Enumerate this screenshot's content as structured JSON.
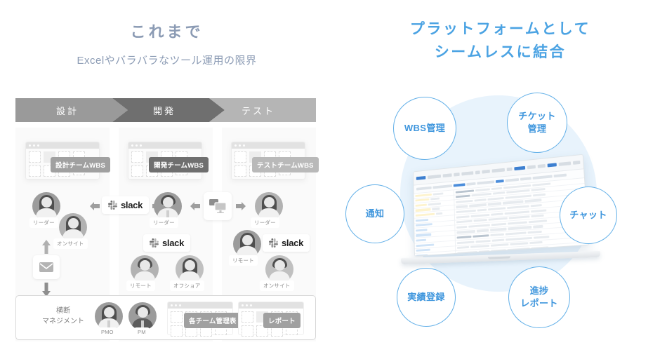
{
  "left": {
    "title": "これまで",
    "subtitle": "Excelやバラバラなツール運用の限界",
    "phases": [
      {
        "label": "設計",
        "color": "#9a9a9a"
      },
      {
        "label": "開発",
        "color": "#6f6f6f"
      },
      {
        "label": "テスト",
        "color": "#b5b5b5"
      }
    ],
    "columns": [
      {
        "wbs_tag": "設計チームWBS",
        "people": [
          {
            "label": "リーダー"
          },
          {
            "label": "オンサイト"
          }
        ],
        "tools": [
          "slack",
          "mail"
        ]
      },
      {
        "wbs_tag": "開発チームWBS",
        "people": [
          {
            "label": "リーダー"
          },
          {
            "label": "リモート"
          },
          {
            "label": "オフショア"
          }
        ],
        "tools": [
          "slack",
          "screen-share"
        ]
      },
      {
        "wbs_tag": "テストチームWBS",
        "people": [
          {
            "label": "リーダー"
          },
          {
            "label": "リモート"
          },
          {
            "label": "オンサイト"
          }
        ],
        "tools": [
          "slack"
        ]
      }
    ],
    "management": {
      "label_line1": "横断",
      "label_line2": "マネジメント",
      "people": [
        {
          "label": "PMO"
        },
        {
          "label": "PM"
        }
      ],
      "documents": [
        {
          "tag": "各チーム管理表"
        },
        {
          "tag": "レポート"
        }
      ]
    },
    "slack_word": "slack"
  },
  "right": {
    "title_line1": "プラットフォームとして",
    "title_line2": "シームレスに結合",
    "accent_color": "#4ba3e3",
    "blob_color": "#e8f3fc",
    "bubbles": [
      {
        "id": "wbs",
        "line1": "WBS管理",
        "line2": ""
      },
      {
        "id": "ticket",
        "line1": "チケット",
        "line2": "管理"
      },
      {
        "id": "notify",
        "line1": "通知",
        "line2": ""
      },
      {
        "id": "chat",
        "line1": "チャット",
        "line2": ""
      },
      {
        "id": "achievement",
        "line1": "実績登録",
        "line2": ""
      },
      {
        "id": "progress",
        "line1": "進捗",
        "line2": "レポート"
      }
    ]
  }
}
